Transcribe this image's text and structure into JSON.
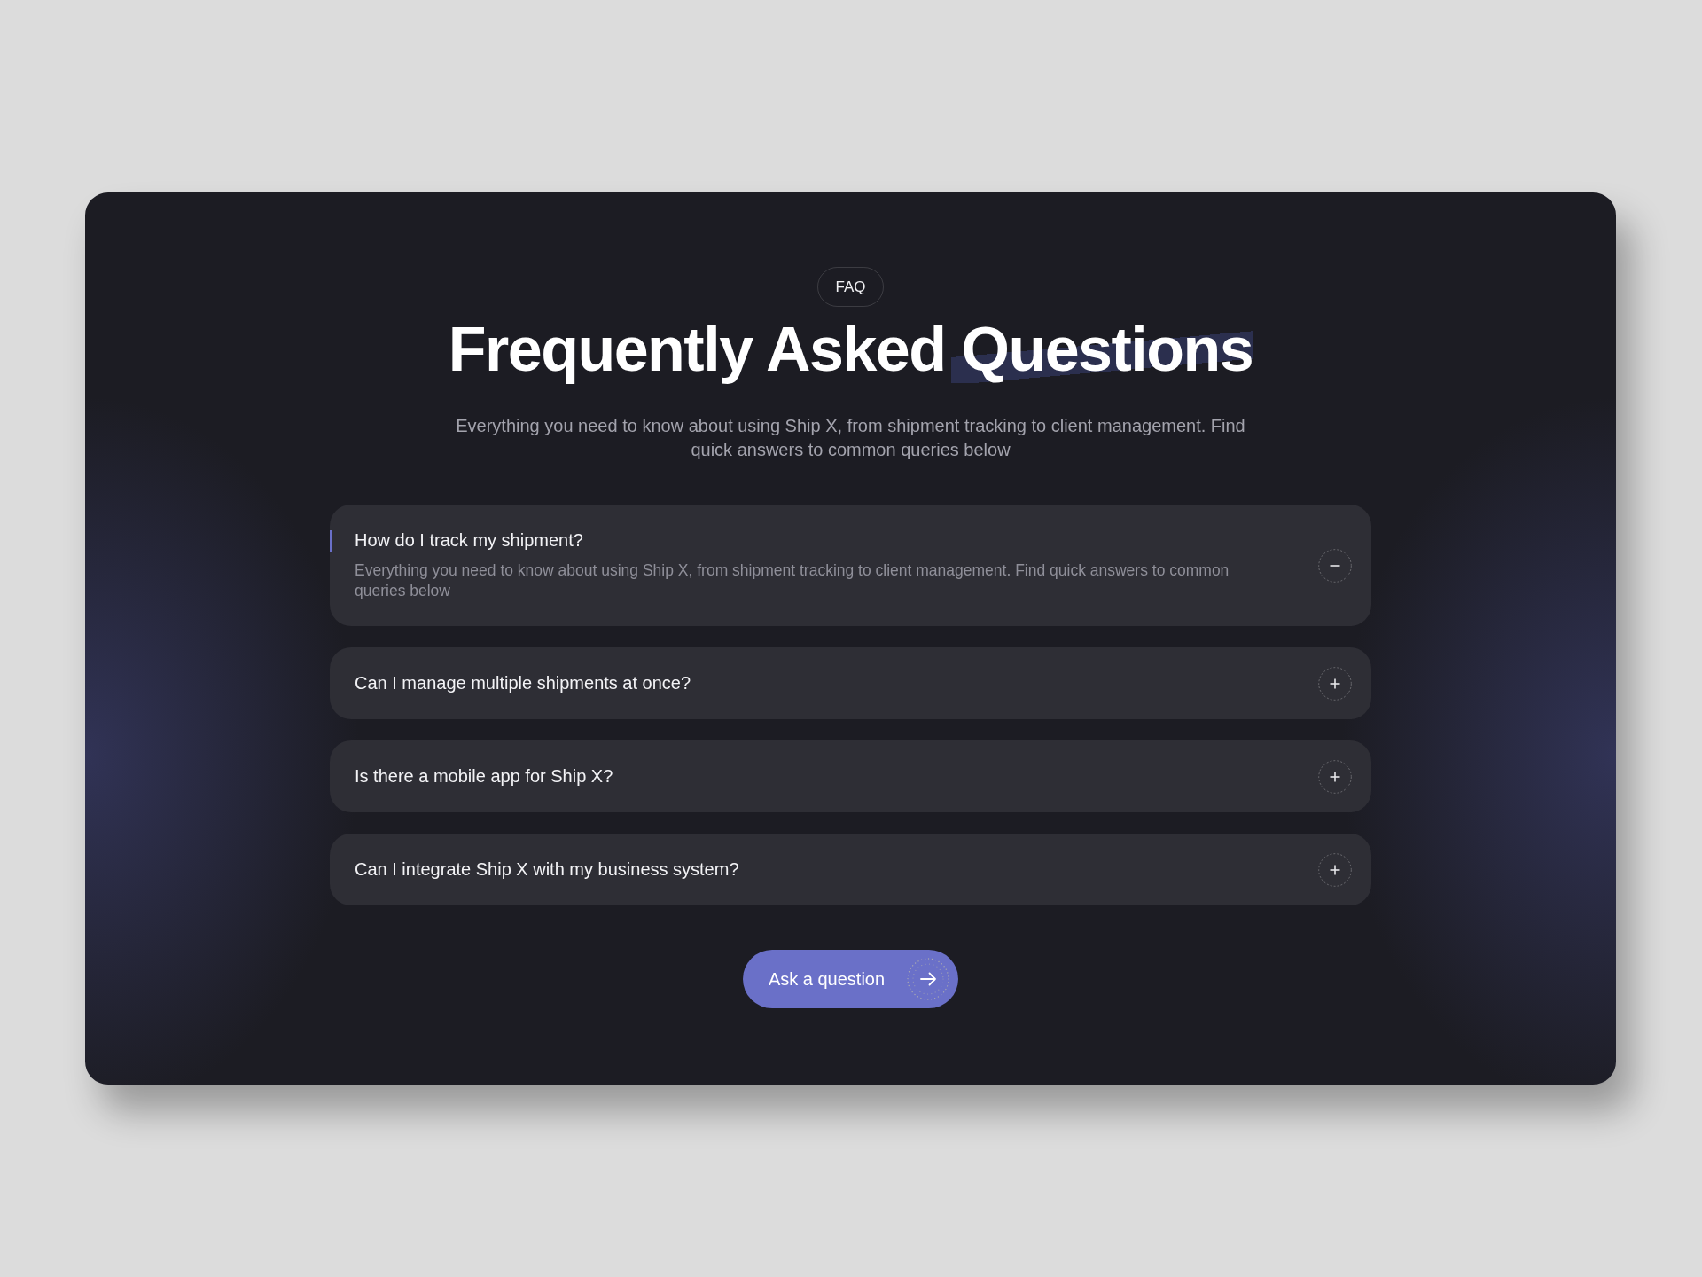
{
  "badge": "FAQ",
  "title": "Frequently Asked Questions",
  "subtitle": "Everything you need to know about using Ship X, from shipment tracking to client management. Find quick answers to common queries below",
  "faq_items": [
    {
      "question": "How do I track my shipment?",
      "answer": "Everything you need to know about using Ship X, from shipment tracking to client management. Find quick answers to common queries below",
      "expanded": true
    },
    {
      "question": "Can I manage multiple shipments at once?",
      "expanded": false
    },
    {
      "question": "Is there a mobile app for Ship X?",
      "expanded": false
    },
    {
      "question": "Can I integrate Ship X with my business system?",
      "expanded": false
    }
  ],
  "cta_button": {
    "label": "Ask a question"
  }
}
